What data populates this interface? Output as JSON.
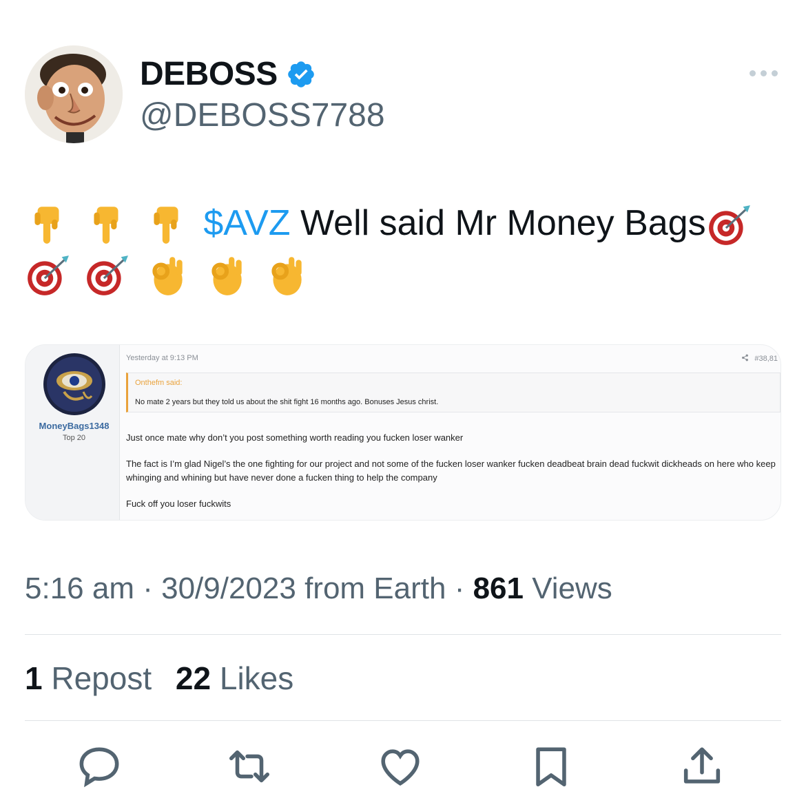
{
  "author": {
    "display_name": "DEBOSS",
    "handle": "@DEBOSS7788",
    "verified": true,
    "verified_color": "#1d9bf0"
  },
  "tweet": {
    "cashtag": "$AVZ",
    "text": " Well said Mr Money Bags",
    "cashtag_color": "#1d9bf0",
    "emojis_before": [
      "backhand-index-pointing-down",
      "backhand-index-pointing-down",
      "backhand-index-pointing-down"
    ],
    "emojis_after": [
      "direct-hit",
      "direct-hit",
      "direct-hit",
      "ok-hand",
      "ok-hand",
      "ok-hand"
    ]
  },
  "media": {
    "date": "Yesterday at 9:13 PM",
    "post_number": "#38,81",
    "username": "MoneyBags1348",
    "rank": "Top 20",
    "quote_author": "Onthefm said:",
    "quote_text": "No mate 2 years but they told us about the shit fight 16 months ago. Bonuses Jesus christ.",
    "body_1": "Just once mate why don’t you post something worth reading you fucken loser wanker",
    "body_2": "The fact is I’m glad Nigel’s the one fighting for our project and not some of the fucken loser wanker fucken deadbeat brain dead fuckwit dickheads on here who keep whinging and whining but have never done a fucken thing to help the company",
    "body_3": "Fuck off you loser fuckwits"
  },
  "meta": {
    "time": "5:16 am",
    "sep1": " · ",
    "date": "30/9/2023",
    "source": " from Earth",
    "sep2": " · ",
    "views_count": "861",
    "views_label": " Views"
  },
  "stats": {
    "reposts_count": "1",
    "reposts_label": " Repost",
    "likes_count": "22",
    "likes_label": " Likes"
  },
  "actions": [
    "reply-icon",
    "repost-icon",
    "like-icon",
    "bookmark-icon",
    "share-icon"
  ],
  "icon_color": "#536471"
}
